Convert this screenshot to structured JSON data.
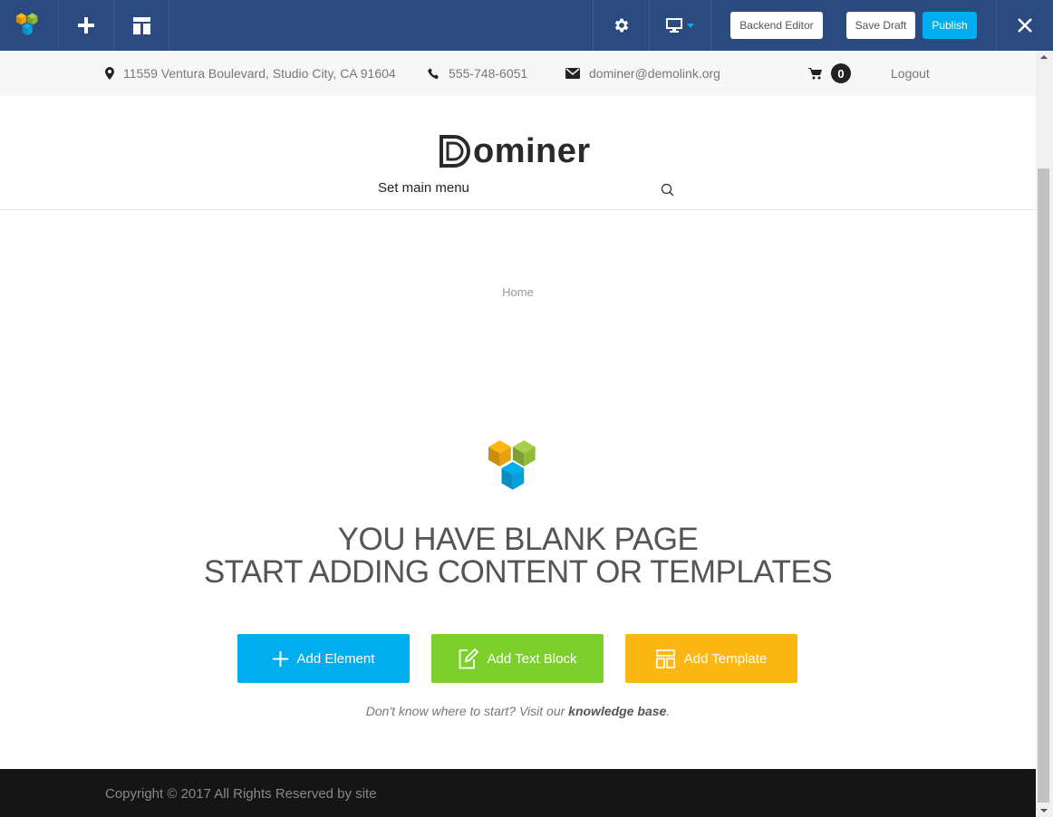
{
  "toolbar": {
    "logo_icon": "vc-cubes-icon",
    "add_icon": "plus-icon",
    "templates_icon": "layout-icon",
    "settings_icon": "gear-icon",
    "responsive_icon": "desktop-monitor-icon",
    "backend_editor_label": "Backend Editor",
    "save_draft_label": "Save Draft",
    "publish_label": "Publish",
    "close_icon": "close-icon",
    "colors": {
      "bar": "#2b4b80",
      "publish": "#00aeef"
    }
  },
  "infobar": {
    "address": "11559 Ventura Boulevard, Studio City, CA 91604",
    "phone": "555-748-6051",
    "email": "dominer@demolink.org",
    "cart_count": "0",
    "logout_label": "Logout"
  },
  "header": {
    "logo_text": "ominer",
    "logo_letter": "D",
    "menu_placeholder": "Set main menu",
    "search_icon": "search-icon"
  },
  "breadcrumb": {
    "home": "Home"
  },
  "blank_page": {
    "title_line1": "YOU HAVE BLANK PAGE",
    "title_line2": "START ADDING CONTENT OR TEMPLATES",
    "buttons": [
      {
        "label": "Add Element",
        "icon": "plus-icon",
        "color": "#00aeef"
      },
      {
        "label": "Add Text Block",
        "icon": "edit-icon",
        "color": "#7dcf2b"
      },
      {
        "label": "Add Template",
        "icon": "template-icon",
        "color": "#fdb714"
      }
    ],
    "hint_prefix": "Don't know where to start? Visit our ",
    "hint_link": "knowledge base",
    "hint_suffix": "."
  },
  "footer": {
    "copyright": "Copyright © 2017 All Rights Reserved by site"
  }
}
